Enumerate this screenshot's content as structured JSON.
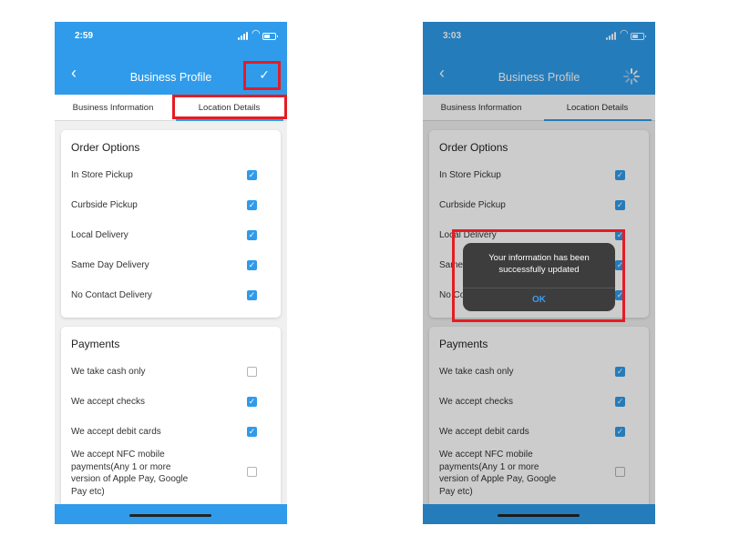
{
  "colors": {
    "primary": "#2f9bea",
    "highlight": "#e51c23",
    "alert_bg": "#3d3d3d",
    "alert_button": "#3b9bf0"
  },
  "nav": {
    "title": "Business Profile",
    "back_icon": "chevron-left-icon",
    "save_icon": "check-icon"
  },
  "tabs": [
    {
      "label": "Business Information"
    },
    {
      "label": "Location Details"
    }
  ],
  "left_screen": {
    "status_time": "2:59",
    "order_options": {
      "title": "Order Options",
      "items": [
        {
          "label": "In Store Pickup",
          "checked": true
        },
        {
          "label": "Curbside Pickup",
          "checked": true
        },
        {
          "label": "Local Delivery",
          "checked": true
        },
        {
          "label": "Same Day Delivery",
          "checked": true
        },
        {
          "label": "No Contact Delivery",
          "checked": true
        }
      ]
    },
    "payments": {
      "title": "Payments",
      "items": [
        {
          "label": "We take cash only",
          "checked": false
        },
        {
          "label": "We accept checks",
          "checked": true
        },
        {
          "label": "We accept debit cards",
          "checked": true
        },
        {
          "label": "We accept NFC mobile payments(Any 1 or more version of Apple Pay, Google Pay etc)",
          "checked": false
        }
      ]
    }
  },
  "right_screen": {
    "status_time": "3:03",
    "order_options": {
      "title": "Order Options",
      "items": [
        {
          "label": "In Store Pickup",
          "checked": true
        },
        {
          "label": "Curbside Pickup",
          "checked": true
        },
        {
          "label": "Local Delivery",
          "checked": true
        },
        {
          "label": "Same Day Delivery",
          "checked": true
        },
        {
          "label": "No Contact Delivery",
          "checked": true
        }
      ]
    },
    "payments": {
      "title": "Payments",
      "items": [
        {
          "label": "We take cash only",
          "checked": true
        },
        {
          "label": "We accept checks",
          "checked": true
        },
        {
          "label": "We accept debit cards",
          "checked": true
        },
        {
          "label": "We accept NFC mobile payments(Any 1 or more version of Apple Pay, Google Pay etc)",
          "checked": false
        }
      ]
    },
    "alert": {
      "message": "Your information has been successfully updated",
      "button": "OK"
    }
  }
}
